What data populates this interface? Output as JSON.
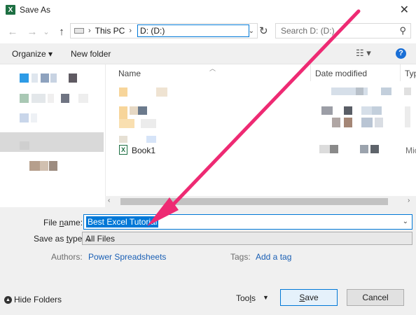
{
  "window": {
    "title": "Save As",
    "app_icon_letter": "X"
  },
  "navigation": {
    "back": "←",
    "forward": "→",
    "recent": "⌄",
    "up": "↑",
    "breadcrumb": [
      "This PC",
      "D: (D:)"
    ],
    "refresh": "↻",
    "search_placeholder": "Search D: (D:)"
  },
  "toolbar": {
    "organize": "Organize ▾",
    "new_folder": "New folder",
    "help": "?"
  },
  "file_list": {
    "columns": {
      "name": "Name",
      "date_modified": "Date modified",
      "type": "Typ"
    },
    "visible_file": {
      "name": "Book1",
      "type_partial": "Mic"
    }
  },
  "form": {
    "file_name_label": {
      "before": "File ",
      "underlined": "n",
      "after": "ame:"
    },
    "file_name_value": "Best Excel Tutorial",
    "save_as_type_label": {
      "before": "Save as ",
      "underlined": "t",
      "after": "ype:"
    },
    "save_as_type_value": "All Files",
    "authors_label": "Authors:",
    "authors_value": "Power Spreadsheets",
    "tags_label": "Tags:",
    "tags_value": "Add a tag"
  },
  "footer": {
    "hide_folders": "Hide Folders",
    "tools": {
      "before": "Too",
      "underlined": "l",
      "after": "s"
    },
    "save": {
      "underlined": "S",
      "after": "ave"
    },
    "cancel": "Cancel"
  },
  "annotation": {
    "arrow_color": "#ee2a73"
  },
  "colors": {
    "accent": "#0078d7",
    "selection": "#0078d7",
    "excel_green": "#1d6f42"
  }
}
